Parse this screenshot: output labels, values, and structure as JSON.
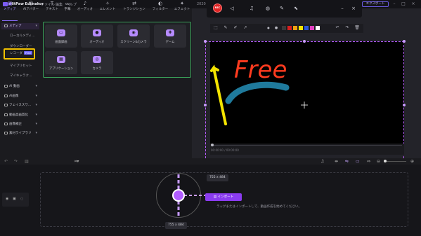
{
  "app": {
    "title": "HitPaw Edimakor",
    "menus": [
      "ファイル",
      "編集",
      "ヘルプ"
    ]
  },
  "header": {
    "export_label": "エクスポート",
    "version_stub": "2020"
  },
  "toolbar": {
    "tabs": [
      {
        "label": "メディア",
        "icon": "media-icon",
        "active": true
      },
      {
        "label": "AIアバター",
        "icon": "avatar-icon"
      },
      {
        "label": "テキスト",
        "icon": "text-icon"
      },
      {
        "label": "字幕",
        "icon": "subtitle-icon"
      },
      {
        "label": "オーディオ",
        "icon": "audio-icon"
      },
      {
        "label": "エレメント",
        "icon": "element-icon"
      },
      {
        "label": "トランジション",
        "icon": "transition-icon"
      },
      {
        "label": "フィルター",
        "icon": "filter-icon"
      },
      {
        "label": "エフェクト",
        "icon": "effect-icon"
      }
    ]
  },
  "sidebar": {
    "items": [
      {
        "label": "メディア",
        "type": "head"
      },
      {
        "label": "ローカルメディ…",
        "type": "sub"
      },
      {
        "label": "ダウンローダー",
        "type": "sub"
      },
      {
        "label": "レコーダ",
        "type": "sub",
        "badge": "Free"
      },
      {
        "label": "マイプリセット",
        "type": "sub"
      },
      {
        "label": "マイキャラク…",
        "type": "sub"
      },
      {
        "label": "AI 動画",
        "type": "group"
      },
      {
        "label": "AI画像",
        "type": "group"
      },
      {
        "label": "フェイススワ…",
        "type": "group"
      },
      {
        "label": "動画高画質化",
        "type": "group"
      },
      {
        "label": "画像補正",
        "type": "group"
      },
      {
        "label": "素材ライブラリ",
        "type": "group"
      }
    ]
  },
  "media_panel": {
    "cards": [
      {
        "label": "画面録画",
        "icon": "monitor-icon"
      },
      {
        "label": "オーディオ",
        "icon": "microphone-icon"
      },
      {
        "label": "スクリーン&カメラ",
        "icon": "screen-camera-icon"
      },
      {
        "label": "ゲーム",
        "icon": "gamepad-icon"
      },
      {
        "label": "アプリケーション",
        "icon": "application-icon"
      },
      {
        "label": "カメラ",
        "icon": "camera-icon"
      }
    ]
  },
  "record_bar": {
    "rec_label": "REC",
    "icons": [
      "speaker-icon",
      "microphone-icon",
      "webcam-icon",
      "pen-icon",
      "cursor-icon"
    ]
  },
  "draw_bar": {
    "swatches": [
      "#3a3a3a",
      "#d81e1e",
      "#f0a010",
      "#f4e400",
      "#2a56d8",
      "#e040c0",
      "#ffffff"
    ]
  },
  "canvas": {
    "annotation_text": "Free",
    "time_readout": "00:00:00 / 00:00:00"
  },
  "timeline": {
    "size_label_top": "755 x 484",
    "size_label_bottom": "755 x 484",
    "import_label": "インポート",
    "drop_hint": "ラッグまたはインポートして、動画作成を始めてください。"
  },
  "colors": {
    "accent": "#8a6cff",
    "record": "#e02424",
    "highlight": "#f0c000",
    "panel_border": "#3aa35a",
    "import": "#8b3cf0"
  }
}
